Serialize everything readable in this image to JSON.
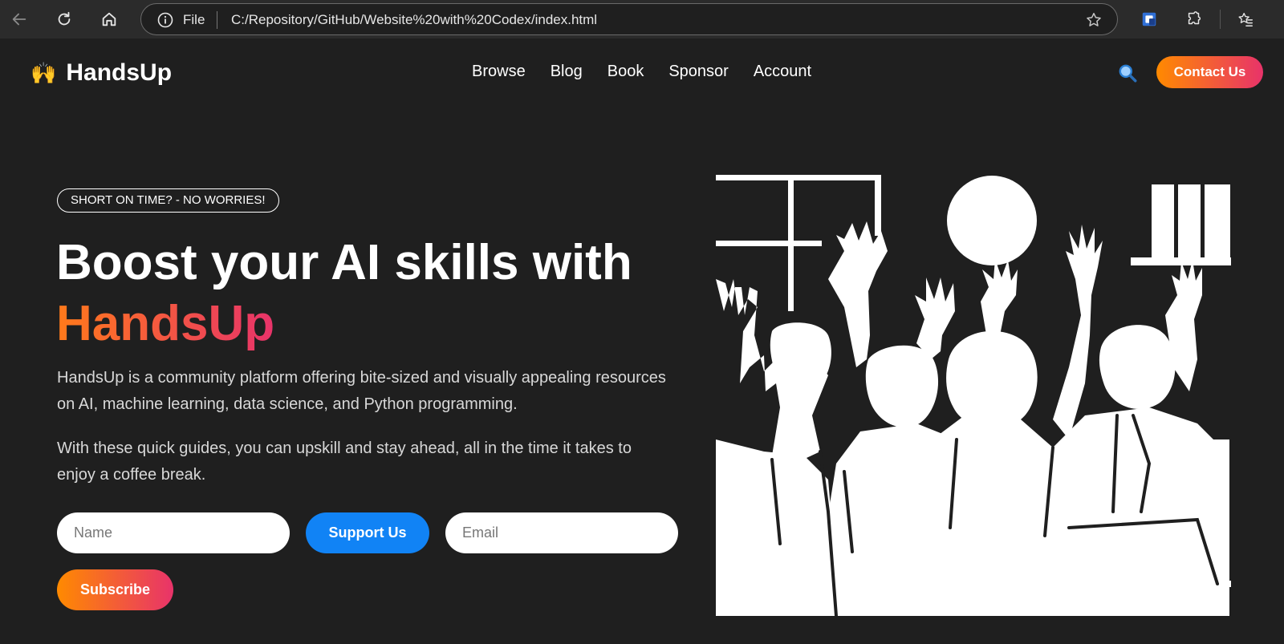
{
  "browser": {
    "scheme_label": "File",
    "url": "C:/Repository/GitHub/Website%20with%20Codex/index.html",
    "icons": [
      "back-arrow-icon",
      "reload-icon",
      "home-icon",
      "info-icon",
      "star-icon",
      "extension-shield-icon",
      "puzzle-icon",
      "favorites-icon"
    ]
  },
  "site": {
    "logo_emoji": "🙌",
    "brand": "HandsUp",
    "nav": [
      "Browse",
      "Blog",
      "Book",
      "Sponsor",
      "Account"
    ],
    "search_icon": "🔍",
    "contact_label": "Contact Us"
  },
  "hero": {
    "badge": "SHORT ON TIME? - NO WORRIES!",
    "headline_line1": "Boost your AI skills with",
    "headline_brand": "HandsUp",
    "paragraph1": "HandsUp is a community platform offering bite-sized and visually appealing resources on AI, machine learning, data science, and Python programming.",
    "paragraph2": "With these quick guides, you can upskill and stay ahead, all in the time it takes to enjoy a coffee break.",
    "name_placeholder": "Name",
    "support_label": "Support Us",
    "email_placeholder": "Email",
    "subscribe_label": "Subscribe"
  },
  "colors": {
    "background": "#1f1f1f",
    "chrome": "#2b2b2b",
    "accent_orange": "#ff8a00",
    "accent_pink": "#e8336a",
    "support_blue": "#1183f5"
  }
}
